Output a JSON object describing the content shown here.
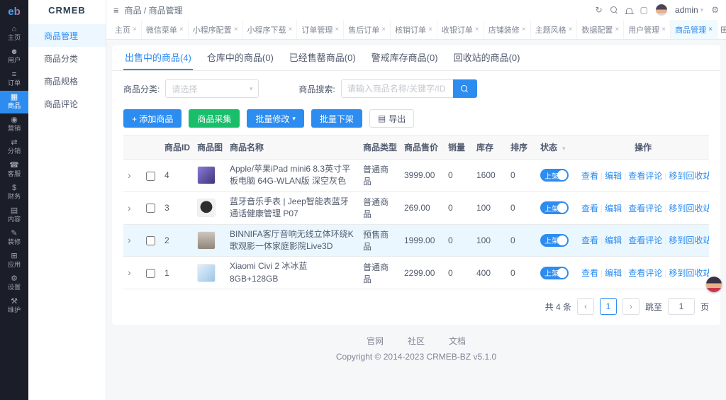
{
  "colors": {
    "primary": "#2d8cf0",
    "success": "#19be6b",
    "sidebar": "#1b1d28",
    "row-highlight": "#ebf7ff"
  },
  "ui": {
    "close": "×",
    "expand": "›",
    "caret": "▾",
    "prev": "‹",
    "next": "›",
    "hamburger": "≡",
    "grid": "⊞",
    "refresh": "↻",
    "fullscreen": "▢",
    "gear": "⚙",
    "funnel": "▼",
    "export_icon": "▤"
  },
  "brand": {
    "logo": "eb",
    "name": "CRMEB"
  },
  "rail": {
    "items": [
      {
        "label": "主页",
        "glyph": "⌂",
        "active": false
      },
      {
        "label": "用户",
        "glyph": "☻",
        "active": false
      },
      {
        "label": "订单",
        "glyph": "≡",
        "active": false
      },
      {
        "label": "商品",
        "glyph": "▦",
        "active": true
      },
      {
        "label": "营销",
        "glyph": "◉",
        "active": false
      },
      {
        "label": "分销",
        "glyph": "⇄",
        "active": false
      },
      {
        "label": "客服",
        "glyph": "☎",
        "active": false
      },
      {
        "label": "财务",
        "glyph": "$",
        "active": false
      },
      {
        "label": "内容",
        "glyph": "▤",
        "active": false
      },
      {
        "label": "装修",
        "glyph": "✎",
        "active": false
      },
      {
        "label": "应用",
        "glyph": "⊞",
        "active": false
      },
      {
        "label": "设置",
        "glyph": "⚙",
        "active": false
      },
      {
        "label": "维护",
        "glyph": "⚒",
        "active": false
      }
    ]
  },
  "subnav": {
    "items": [
      {
        "label": "商品管理",
        "active": true
      },
      {
        "label": "商品分类",
        "active": false
      },
      {
        "label": "商品规格",
        "active": false
      },
      {
        "label": "商品评论",
        "active": false
      }
    ]
  },
  "topbar": {
    "breadcrumb": "商品 / 商品管理",
    "username": "admin"
  },
  "tags": {
    "items": [
      {
        "label": "主页",
        "active": false
      },
      {
        "label": "微信菜单",
        "active": false
      },
      {
        "label": "小程序配置",
        "active": false
      },
      {
        "label": "小程序下载",
        "active": false
      },
      {
        "label": "订单管理",
        "active": false
      },
      {
        "label": "售后订单",
        "active": false
      },
      {
        "label": "核销订单",
        "active": false
      },
      {
        "label": "收银订单",
        "active": false
      },
      {
        "label": "店铺装修",
        "active": false
      },
      {
        "label": "主题风格",
        "active": false
      },
      {
        "label": "数据配置",
        "active": false
      },
      {
        "label": "用户管理",
        "active": false
      },
      {
        "label": "商品管理",
        "active": true
      }
    ]
  },
  "card": {
    "tabs": [
      {
        "label": "出售中的商品(4)",
        "active": true
      },
      {
        "label": "仓库中的商品(0)",
        "active": false
      },
      {
        "label": "已经售罄商品(0)",
        "active": false
      },
      {
        "label": "警戒库存商品(0)",
        "active": false
      },
      {
        "label": "回收站的商品(0)",
        "active": false
      }
    ],
    "filters": {
      "category_label": "商品分类:",
      "category_placeholder": "请选择",
      "search_label": "商品搜索:",
      "search_placeholder": "请输入商品名称/关键字/ID"
    },
    "buttons": {
      "add": "+ 添加商品",
      "collect": "商品采集",
      "batch_edit": "批量修改",
      "batch_off": "批量下架",
      "export": "导出"
    },
    "table": {
      "headers": [
        "商品ID",
        "商品图",
        "商品名称",
        "商品类型",
        "商品售价",
        "销量",
        "库存",
        "排序",
        "状态",
        "操作"
      ],
      "actions": [
        "查看",
        "编辑",
        "查看评论",
        "移到回收站"
      ],
      "rows": [
        {
          "id": "4",
          "name": "Apple/苹果iPad mini6 8.3英寸平板电脑 64G-WLAN版 深空灰色",
          "type": "普通商品",
          "price": "3999.00",
          "sales": "0",
          "stock": "1600",
          "sort": "0",
          "status": "上架",
          "thumb": "linear-gradient(135deg,#8a7bd8,#41337a)",
          "highlight": false
        },
        {
          "id": "3",
          "name": "蓝牙音乐手表 | Jeep智能表蓝牙通话健康管理 P07",
          "type": "普通商品",
          "price": "269.00",
          "sales": "0",
          "stock": "100",
          "sort": "0",
          "status": "上架",
          "thumb": "radial-gradient(circle at 50% 45%,#2e2e2e 46%,#f1f1f1 48%)",
          "highlight": false
        },
        {
          "id": "2",
          "name": "BINNIFA客厅音响无线立体环绕K歌观影一体家庭影院Live3D",
          "type": "预售商品",
          "price": "1999.00",
          "sales": "0",
          "stock": "100",
          "sort": "0",
          "status": "上架",
          "thumb": "linear-gradient(180deg,#cfc6bb,#8e857c)",
          "highlight": true
        },
        {
          "id": "1",
          "name": "Xiaomi Civi 2 冰冰蓝 8GB+128GB",
          "type": "普通商品",
          "price": "2299.00",
          "sales": "0",
          "stock": "400",
          "sort": "0",
          "status": "上架",
          "thumb": "linear-gradient(135deg,#e3f0fb,#9cc6e8)",
          "highlight": false
        }
      ]
    },
    "pagination": {
      "total": "共 4 条",
      "current": "1",
      "jump_before": "跳至",
      "jump_value": "1",
      "jump_after": "页"
    }
  },
  "footer": {
    "links": [
      "官网",
      "社区",
      "文档"
    ],
    "copyright": "Copyright © 2014-2023 CRMEB-BZ v5.1.0"
  }
}
